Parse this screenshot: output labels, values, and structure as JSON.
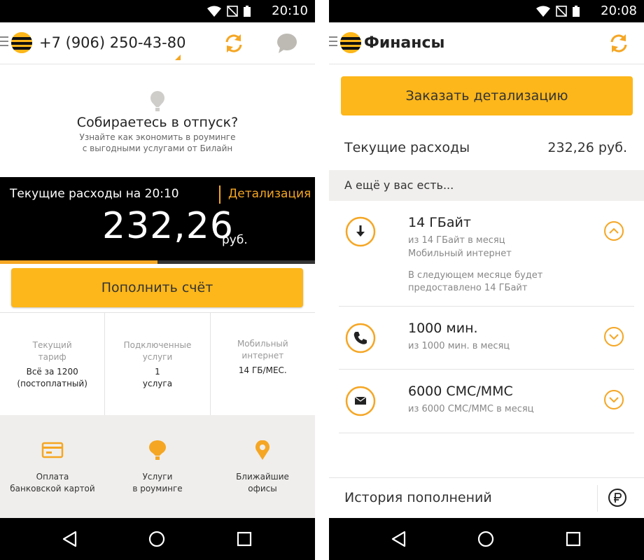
{
  "left_screen": {
    "status_time": "20:10",
    "phone_number": "+7 (906) 250-43-80",
    "promo": {
      "title": "Собираетесь в отпуск?",
      "line1": "Узнайте как экономить в роуминге",
      "line2": "с выгодными услугами от Билайн"
    },
    "balance": {
      "label": "Текущие расходы на 20:10",
      "details_link": "Детализация",
      "amount": "232,26",
      "unit": "руб.",
      "progress_fraction": 0.5
    },
    "topup_label": "Пополнить счёт",
    "info": [
      {
        "title1": "Текущий",
        "title2": "тариф",
        "value1": "Всё за 1200",
        "value2": "(постоплатный)"
      },
      {
        "title1": "Подключенные",
        "title2": "услуги",
        "value1": "1",
        "value2": "услуга"
      },
      {
        "title1": "Мобильный",
        "title2": "интернет",
        "value1": "14 ГБ/МЕС.",
        "value2": ""
      }
    ],
    "quick_actions": [
      {
        "icon": "card-icon",
        "line1": "Оплата",
        "line2": "банковской картой"
      },
      {
        "icon": "balloon-icon",
        "line1": "Услуги",
        "line2": "в роуминге"
      },
      {
        "icon": "location-pin-icon",
        "line1": "Ближайшие",
        "line2": "офисы"
      }
    ]
  },
  "right_screen": {
    "status_time": "20:08",
    "title": "Финансы",
    "order_details_label": "Заказать детализацию",
    "expenses_label": "Текущие расходы",
    "expenses_value": "232,26 руб.",
    "section_header": "А ещё у вас есть...",
    "packages": [
      {
        "icon": "download-icon",
        "title": "14 ГБайт",
        "sub1": "из 14 ГБайт в месяц",
        "sub2": "Мобильный интернет",
        "note1": "В следующем месяце будет",
        "note2": "предоставлено 14 ГБайт",
        "expanded": true
      },
      {
        "icon": "phone-icon",
        "title": "1000 мин.",
        "sub1": "из 1000 мин. в месяц",
        "expanded": false
      },
      {
        "icon": "envelope-icon",
        "title": "6000 СМС/ММС",
        "sub1": "из 6000 СМС/ММС в месяц",
        "expanded": false
      }
    ],
    "history_label": "История пополнений"
  },
  "colors": {
    "accent": "#fdb71a",
    "accent_text": "#f5a623",
    "dark": "#000000",
    "panel": "#efeeec"
  }
}
